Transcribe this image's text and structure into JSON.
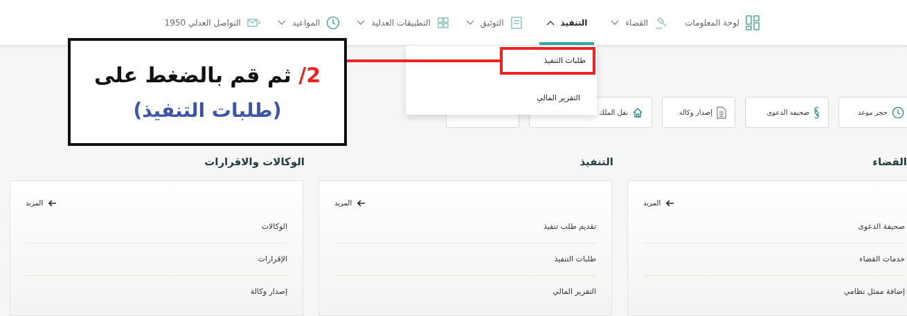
{
  "nav": [
    {
      "label": "لوحة المعلومات",
      "selected": false,
      "expandable": false
    },
    {
      "label": "القضاء",
      "selected": false,
      "expandable": true
    },
    {
      "label": "التنفيذ",
      "selected": true,
      "expandable": true
    },
    {
      "label": "التوثيق",
      "selected": false,
      "expandable": true
    },
    {
      "label": "التطبيقات العدلية",
      "selected": false,
      "expandable": true
    },
    {
      "label": "المواعيد",
      "selected": false,
      "expandable": true
    },
    {
      "label": "التواصل العدلي 1950",
      "selected": false,
      "expandable": false
    }
  ],
  "dropdown": {
    "items": [
      {
        "label": "طلبات التنفيذ",
        "highlighted": true
      },
      {
        "label": "التقرير المالي",
        "highlighted": false
      }
    ]
  },
  "quick_actions": [
    "حجز موعد",
    "صحيفة الدعوى",
    "إصدار وكالة",
    "نقل الملك"
  ],
  "sections": [
    {
      "title": "القضاء",
      "more": "المزيد",
      "items": [
        "صحيفة الدعوى",
        "خدمات القضاء",
        "إضافة ممثل نظامي"
      ]
    },
    {
      "title": "التنفيذ",
      "more": "المزيد",
      "items": [
        "تقديم طلب تنفيذ",
        "طلبات التنفيذ",
        "التقرير المالي"
      ]
    },
    {
      "title": "الوكالات والاقرارات",
      "more": "المزيد",
      "items": [
        "الوكالات",
        "الإقرارات",
        "إصدار وكالة"
      ]
    }
  ],
  "annotation": {
    "step": "2/",
    "line_1": "ثم قم بالضغط على",
    "line_2": "(طلبات التنفيذ)"
  }
}
